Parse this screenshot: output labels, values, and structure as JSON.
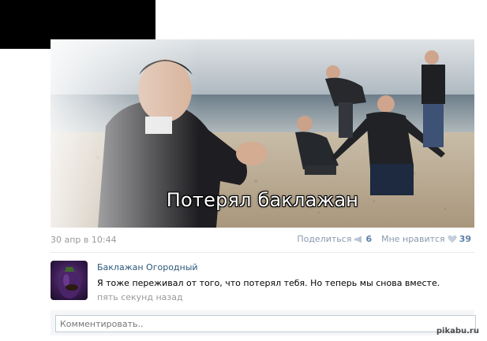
{
  "post": {
    "caption": "Потерял баклажан",
    "date": "30 апр в 10:44",
    "share_label": "Поделиться",
    "share_count": "6",
    "like_label": "Мне нравится",
    "like_count": "39"
  },
  "comment": {
    "author": "Баклажан Огородный",
    "text": "Я тоже переживал от того, что потерял тебя. Но теперь мы снова вместе.",
    "time": "пять секунд назад"
  },
  "comment_form": {
    "placeholder": "Комментировать.."
  },
  "watermark": "pikabu.ru",
  "colors": {
    "link": "#2b587a",
    "count": "#5e81a8",
    "muted": "#999999",
    "action": "#8a99ad"
  },
  "icons": [
    "megaphone-icon",
    "heart-icon"
  ]
}
